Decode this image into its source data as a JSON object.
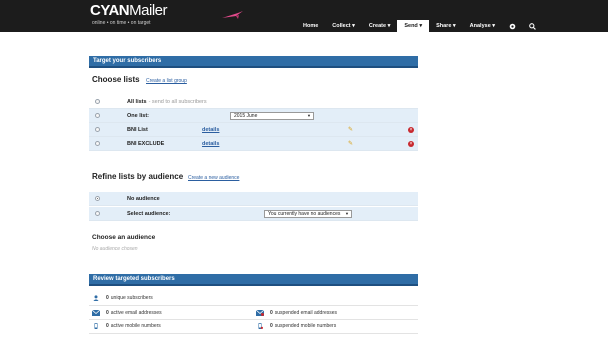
{
  "brand": {
    "logo_main": "CYAN",
    "logo_rest": "ailer",
    "logo_m": "M",
    "tagline": "online • on time • on target"
  },
  "nav": {
    "items": [
      {
        "label": "Home"
      },
      {
        "label": "Collect ▾"
      },
      {
        "label": "Create ▾"
      },
      {
        "label": "Send ▾"
      },
      {
        "label": "Share ▾"
      },
      {
        "label": "Analyse ▾"
      }
    ],
    "settings_icon": "gear-icon",
    "search_icon": "search-icon"
  },
  "target": {
    "panel_title": "Target your subscribers",
    "choose_lists_title": "Choose lists",
    "create_list_group_link": "Create a list group",
    "all_lists_label": "All lists",
    "all_lists_hint": "- send to all subscribers",
    "one_list_label": "One list:",
    "one_list_value": "2015 June",
    "lists": [
      {
        "name": "BNI List",
        "details": "details"
      },
      {
        "name": "BNI EXCLUDE",
        "details": "details"
      }
    ]
  },
  "refine": {
    "title": "Refine lists by audience",
    "create_audience_link": "Create a new audience",
    "no_audience_label": "No audience",
    "select_audience_label": "Select audience:",
    "select_audience_value": "You currently have no audiences"
  },
  "choose_audience": {
    "title": "Choose an audience",
    "placeholder": "No audience chosen"
  },
  "review": {
    "panel_title": "Review targeted subscribers",
    "unique": {
      "count": "0",
      "label": "unique subscribers"
    },
    "active_email": {
      "count": "0",
      "label": "active email addresses"
    },
    "suspended_email": {
      "count": "0",
      "label": "suspended email addresses"
    },
    "active_mobile": {
      "count": "0",
      "label": "active mobile numbers"
    },
    "suspended_mobile": {
      "count": "0",
      "label": "suspended mobile numbers"
    }
  },
  "colors": {
    "header_bg": "#1c1c1c",
    "panel_blue": "#2f6da6",
    "row_blue": "#e3eef8",
    "link": "#2b5ea0",
    "delete_red": "#c8282e"
  }
}
